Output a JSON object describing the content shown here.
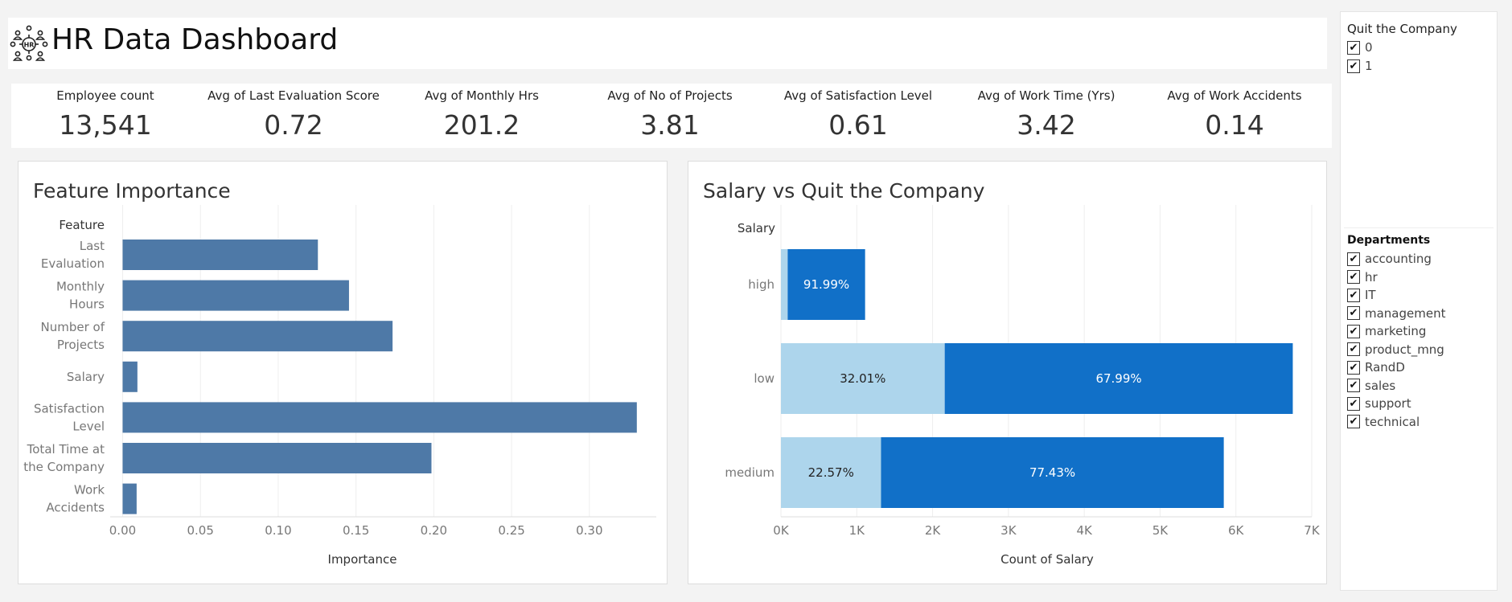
{
  "header": {
    "title": "HR Data Dashboard",
    "logo_icon": "hr-people-network-icon"
  },
  "kpis": [
    {
      "label": "Employee count",
      "value": "13,541"
    },
    {
      "label": "Avg of Last Evaluation Score",
      "value": "0.72"
    },
    {
      "label": "Avg of Monthly Hrs",
      "value": "201.2"
    },
    {
      "label": "Avg of No of Projects",
      "value": "3.81"
    },
    {
      "label": "Avg of Satisfaction Level",
      "value": "0.61"
    },
    {
      "label": "Avg of Work Time (Yrs)",
      "value": "3.42"
    },
    {
      "label": "Avg of Work Accidents",
      "value": "0.14"
    }
  ],
  "filters": {
    "quit": {
      "title": "Quit the Company",
      "items": [
        {
          "label": "0",
          "checked": true
        },
        {
          "label": "1",
          "checked": true
        }
      ]
    },
    "departments": {
      "title": "Departments",
      "items": [
        {
          "label": "accounting",
          "checked": true
        },
        {
          "label": "hr",
          "checked": true
        },
        {
          "label": "IT",
          "checked": true
        },
        {
          "label": "management",
          "checked": true
        },
        {
          "label": "marketing",
          "checked": true
        },
        {
          "label": "product_mng",
          "checked": true
        },
        {
          "label": "RandD",
          "checked": true
        },
        {
          "label": "sales",
          "checked": true
        },
        {
          "label": "support",
          "checked": true
        },
        {
          "label": "technical",
          "checked": true
        }
      ]
    }
  },
  "colors": {
    "feature_bar": "#4e79a7",
    "quit_0": "#add5ec",
    "quit_1": "#1170c8",
    "grid": "#eeeeee"
  },
  "chart_data": [
    {
      "type": "bar",
      "orientation": "horizontal",
      "title": "Feature Importance",
      "ylabel": "Feature",
      "xlabel": "Importance",
      "categories": [
        [
          "Last",
          "Evaluation"
        ],
        [
          "Monthly",
          "Hours"
        ],
        [
          "Number of",
          "Projects"
        ],
        [
          "Salary"
        ],
        [
          "Satisfaction",
          "Level"
        ],
        [
          "Total Time at",
          "the Company"
        ],
        [
          "Work",
          "Accidents"
        ]
      ],
      "values": [
        0.1255,
        0.1455,
        0.1735,
        0.0095,
        0.3305,
        0.1985,
        0.009
      ],
      "xlim": [
        -0.008,
        0.343
      ],
      "xticks": [
        0.0,
        0.05,
        0.1,
        0.15,
        0.2,
        0.25,
        0.3
      ],
      "xtick_labels": [
        "0.00",
        "0.05",
        "0.10",
        "0.15",
        "0.20",
        "0.25",
        "0.30"
      ],
      "grid": "vertical"
    },
    {
      "type": "bar",
      "orientation": "horizontal",
      "stacked": true,
      "title": "Salary vs Quit the Company",
      "ylabel": "Salary",
      "xlabel": "Count of Salary",
      "categories": [
        "high",
        "low",
        "medium"
      ],
      "series": [
        {
          "values": [
            89,
            2160,
            1320
          ],
          "labels": [
            "",
            "32.01%",
            "22.57%"
          ]
        },
        {
          "values": [
            1021,
            4590,
            4520
          ],
          "labels": [
            "91.99%",
            "67.99%",
            "77.43%"
          ]
        }
      ],
      "xlim": [
        0,
        7000
      ],
      "xticks": [
        0,
        1000,
        2000,
        3000,
        4000,
        5000,
        6000,
        7000
      ],
      "xtick_labels": [
        "0K",
        "1K",
        "2K",
        "3K",
        "4K",
        "5K",
        "6K",
        "7K"
      ],
      "grid": "vertical"
    }
  ]
}
